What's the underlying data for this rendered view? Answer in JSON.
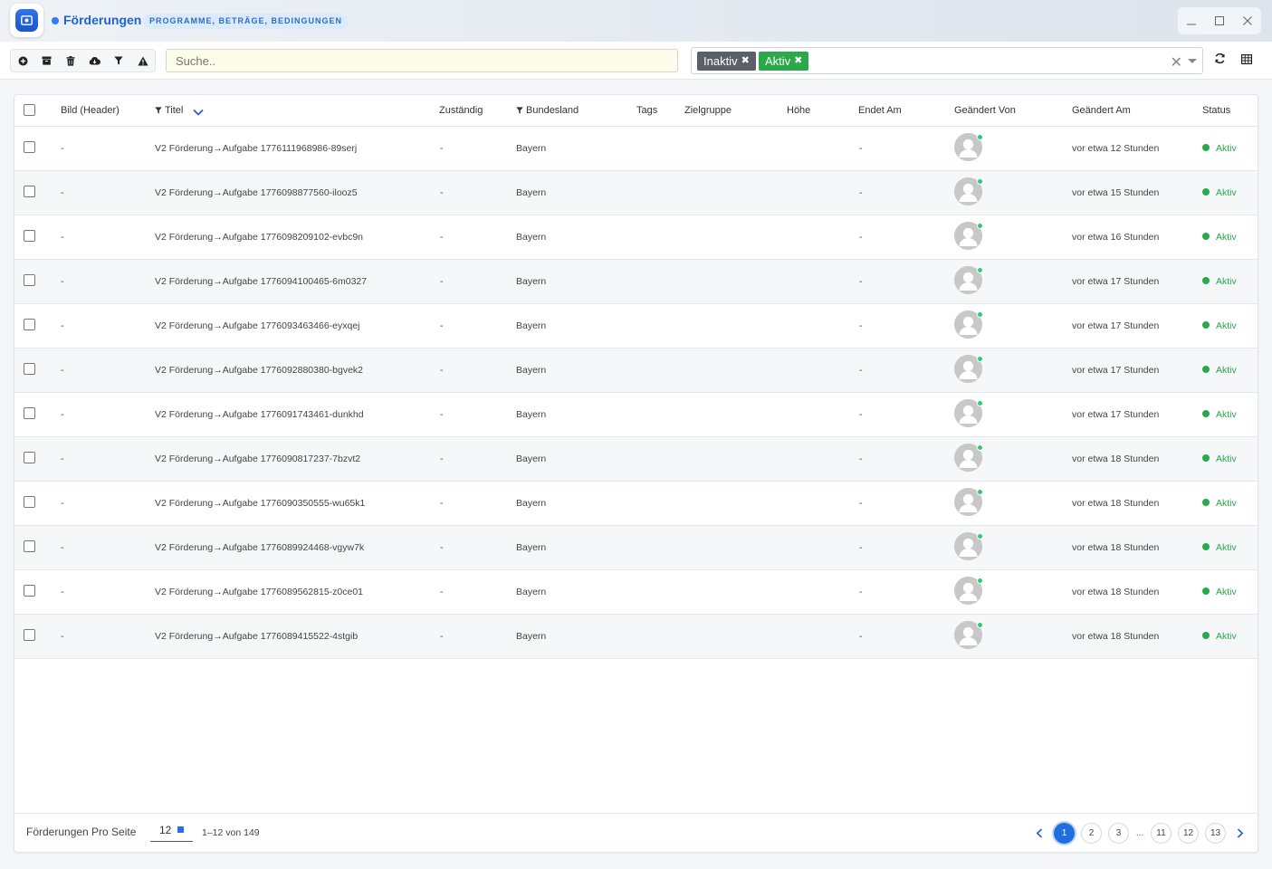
{
  "app": {
    "title": "Förderungen",
    "subtitle_badge": "PROGRAMME, BETRÄGE, BEDINGUNGEN",
    "accent_color": "#1d63d6"
  },
  "window_controls": {
    "minimize_icon": "minimize-icon",
    "maximize_icon": "maximize-icon",
    "close_icon": "close-icon"
  },
  "toolbar": {
    "buttons": [
      {
        "icon": "add-icon"
      },
      {
        "icon": "archive-icon"
      },
      {
        "icon": "trash-icon"
      },
      {
        "icon": "cloud-download-icon"
      },
      {
        "icon": "filter-icon"
      },
      {
        "icon": "warning-icon"
      }
    ],
    "search_placeholder": "Suche..",
    "status_filter": {
      "chips": [
        {
          "label": "Inaktiv",
          "color": "#5b6068"
        },
        {
          "label": "Aktiv",
          "color": "#2aa84a"
        }
      ]
    }
  },
  "table": {
    "columns": [
      {
        "key": "bild",
        "label": "Bild (Header)"
      },
      {
        "key": "titel",
        "label": "Titel",
        "filtered": true,
        "sorted": "desc"
      },
      {
        "key": "zustaendig",
        "label": "Zuständig"
      },
      {
        "key": "bundesland",
        "label": "Bundesland",
        "filtered": true
      },
      {
        "key": "tags",
        "label": "Tags"
      },
      {
        "key": "zielgruppe",
        "label": "Zielgruppe"
      },
      {
        "key": "hoehe",
        "label": "Höhe"
      },
      {
        "key": "endet_am",
        "label": "Endet Am"
      },
      {
        "key": "geaendert_von",
        "label": "Geändert Von"
      },
      {
        "key": "geaendert_am",
        "label": "Geändert Am"
      },
      {
        "key": "status",
        "label": "Status"
      }
    ],
    "rows": [
      {
        "bild": "-",
        "titel": "V2 Förderung→Aufgabe 1776111968986-89serj",
        "zustaendig": "-",
        "bundesland": "Bayern",
        "endet_am": "-",
        "geaendert_am": "vor etwa 12 Stunden",
        "status": "Aktiv"
      },
      {
        "bild": "-",
        "titel": "V2 Förderung→Aufgabe 1776098877560-ilooz5",
        "zustaendig": "-",
        "bundesland": "Bayern",
        "endet_am": "-",
        "geaendert_am": "vor etwa 15 Stunden",
        "status": "Aktiv"
      },
      {
        "bild": "-",
        "titel": "V2 Förderung→Aufgabe 1776098209102-evbc9n",
        "zustaendig": "-",
        "bundesland": "Bayern",
        "endet_am": "-",
        "geaendert_am": "vor etwa 16 Stunden",
        "status": "Aktiv"
      },
      {
        "bild": "-",
        "titel": "V2 Förderung→Aufgabe 1776094100465-6m0327",
        "zustaendig": "-",
        "bundesland": "Bayern",
        "endet_am": "-",
        "geaendert_am": "vor etwa 17 Stunden",
        "status": "Aktiv"
      },
      {
        "bild": "-",
        "titel": "V2 Förderung→Aufgabe 1776093463466-eyxqej",
        "zustaendig": "-",
        "bundesland": "Bayern",
        "endet_am": "-",
        "geaendert_am": "vor etwa 17 Stunden",
        "status": "Aktiv"
      },
      {
        "bild": "-",
        "titel": "V2 Förderung→Aufgabe 1776092880380-bgvek2",
        "zustaendig": "-",
        "bundesland": "Bayern",
        "endet_am": "-",
        "geaendert_am": "vor etwa 17 Stunden",
        "status": "Aktiv"
      },
      {
        "bild": "-",
        "titel": "V2 Förderung→Aufgabe 1776091743461-dunkhd",
        "zustaendig": "-",
        "bundesland": "Bayern",
        "endet_am": "-",
        "geaendert_am": "vor etwa 17 Stunden",
        "status": "Aktiv"
      },
      {
        "bild": "-",
        "titel": "V2 Förderung→Aufgabe 1776090817237-7bzvt2",
        "zustaendig": "-",
        "bundesland": "Bayern",
        "endet_am": "-",
        "geaendert_am": "vor etwa 18 Stunden",
        "status": "Aktiv"
      },
      {
        "bild": "-",
        "titel": "V2 Förderung→Aufgabe 1776090350555-wu65k1",
        "zustaendig": "-",
        "bundesland": "Bayern",
        "endet_am": "-",
        "geaendert_am": "vor etwa 18 Stunden",
        "status": "Aktiv"
      },
      {
        "bild": "-",
        "titel": "V2 Förderung→Aufgabe 1776089924468-vgyw7k",
        "zustaendig": "-",
        "bundesland": "Bayern",
        "endet_am": "-",
        "geaendert_am": "vor etwa 18 Stunden",
        "status": "Aktiv"
      },
      {
        "bild": "-",
        "titel": "V2 Förderung→Aufgabe 1776089562815-z0ce01",
        "zustaendig": "-",
        "bundesland": "Bayern",
        "endet_am": "-",
        "geaendert_am": "vor etwa 18 Stunden",
        "status": "Aktiv"
      },
      {
        "bild": "-",
        "titel": "V2 Förderung→Aufgabe 1776089415522-4stgib",
        "zustaendig": "-",
        "bundesland": "Bayern",
        "endet_am": "-",
        "geaendert_am": "vor etwa 18 Stunden",
        "status": "Aktiv"
      }
    ],
    "status_color": "#2aa84a"
  },
  "footer": {
    "per_page_label": "Förderungen Pro Seite",
    "per_page_value": "12",
    "range_text": "1–12 von 149",
    "pages": [
      "1",
      "2",
      "3",
      "...",
      "11",
      "12",
      "13"
    ],
    "active_page": "1"
  }
}
